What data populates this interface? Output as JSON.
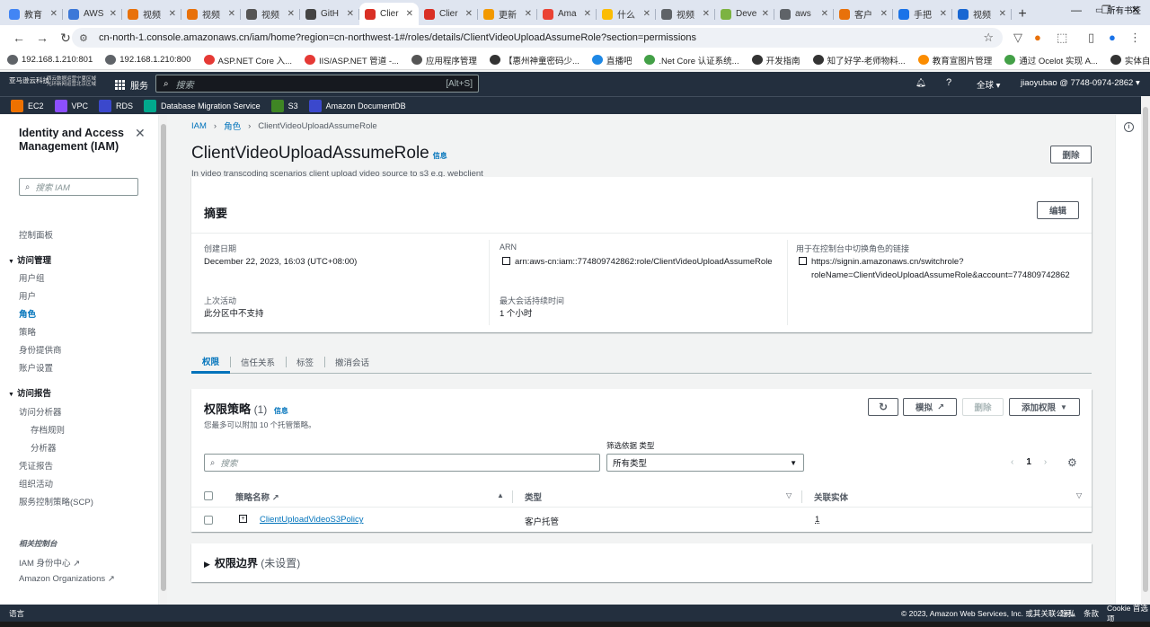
{
  "browser": {
    "tabs": [
      {
        "label": "教育",
        "color": "#4285f4"
      },
      {
        "label": "AWS",
        "color": "#3c78d8"
      },
      {
        "label": "视频",
        "color": "#e8710a"
      },
      {
        "label": "视频",
        "color": "#e8710a"
      },
      {
        "label": "视频",
        "color": "#555555"
      },
      {
        "label": "GitH",
        "color": "#444444"
      },
      {
        "label": "Clier",
        "color": "#d93025",
        "active": true
      },
      {
        "label": "Clier",
        "color": "#d93025"
      },
      {
        "label": "更新",
        "color": "#f29900"
      },
      {
        "label": "Ama",
        "color": "#ea4335"
      },
      {
        "label": "什么",
        "color": "#fbbc04"
      },
      {
        "label": "视频",
        "color": "#5f6368"
      },
      {
        "label": "Deve",
        "color": "#7cb342"
      },
      {
        "label": "aws",
        "color": "#5f6368"
      },
      {
        "label": "客户",
        "color": "#e8710a"
      },
      {
        "label": "手把",
        "color": "#1a73e8"
      },
      {
        "label": "视频",
        "color": "#1967d2"
      }
    ],
    "new_tab": "+",
    "url": "cn-north-1.console.amazonaws.cn/iam/home?region=cn-northwest-1#/roles/details/ClientVideoUploadAssumeRole?section=permissions",
    "bookmarks": [
      {
        "label": "192.168.1.210:801",
        "color": "#5f6368"
      },
      {
        "label": "192.168.1.210:800",
        "color": "#5f6368"
      },
      {
        "label": "ASP.NET Core 入...",
        "color": "#e53935"
      },
      {
        "label": "IIS/ASP.NET 管道 -...",
        "color": "#e53935"
      },
      {
        "label": "应用程序管理",
        "color": "#555555"
      },
      {
        "label": "【惠州神童密码少...",
        "color": "#333333"
      },
      {
        "label": "直播吧",
        "color": "#1e88e5"
      },
      {
        "label": ".Net Core 认证系统...",
        "color": "#43a047"
      },
      {
        "label": "开发指南",
        "color": "#333333"
      },
      {
        "label": "知了好学-老师物料...",
        "color": "#333333"
      },
      {
        "label": "教育宣图片管理",
        "color": "#fb8c00"
      },
      {
        "label": "通过 Ocelot 实现 A...",
        "color": "#43a047"
      },
      {
        "label": "实体自动生成器",
        "color": "#333333"
      }
    ],
    "all_bookmarks": "所有书签"
  },
  "aws_nav": {
    "logo_line1": "亚马逊云科技",
    "logo_line2a": "西云数据运营宁夏区域",
    "logo_line2b": "光环新网运营北京区域",
    "services_label": "服务",
    "search_placeholder": "搜索",
    "search_shortcut": "[Alt+S]",
    "region": "全球 ▾",
    "account": "jiaoyubao @ 7748-0974-2862 ▾"
  },
  "favorites": [
    {
      "label": "EC2",
      "color": "#ed7100",
      "abbr": "EC2"
    },
    {
      "label": "VPC",
      "color": "#8c4fff",
      "abbr": "VPC"
    },
    {
      "label": "RDS",
      "color": "#3b48cc",
      "abbr": "RDS"
    },
    {
      "label": "Database Migration Service",
      "color": "#01a88d",
      "abbr": "DMS"
    },
    {
      "label": "S3",
      "color": "#3f8624",
      "abbr": "S3"
    },
    {
      "label": "Amazon DocumentDB",
      "color": "#3b48cc",
      "abbr": "DB"
    }
  ],
  "sidebar": {
    "title": "Identity and Access Management (IAM)",
    "search_placeholder": "搜索 IAM",
    "dashboard": "控制面板",
    "access_mgmt": "访问管理",
    "access_items": [
      "用户组",
      "用户",
      "角色",
      "策略",
      "身份提供商",
      "账户设置"
    ],
    "access_reports": "访问报告",
    "report_items": [
      "访问分析器",
      "存档规则",
      "分析器",
      "凭证报告",
      "组织活动",
      "服务控制策略(SCP)"
    ],
    "related": "相关控制台",
    "related_items": [
      "IAM 身份中心",
      "Amazon Organizations"
    ]
  },
  "breadcrumb": {
    "root": "IAM",
    "mid": "角色",
    "current": "ClientVideoUploadAssumeRole"
  },
  "role": {
    "name": "ClientVideoUploadAssumeRole",
    "info": "信息",
    "description": "In video transcoding scenarios client upload video source to s3 e.g. webclient",
    "delete_label": "删除"
  },
  "summary": {
    "title": "摘要",
    "edit_label": "编辑",
    "created_label": "创建日期",
    "created_value": "December 22, 2023, 16:03 (UTC+08:00)",
    "arn_label": "ARN",
    "arn_value": "arn:aws-cn:iam::774809742862:role/ClientVideoUploadAssumeRole",
    "switch_label": "用于在控制台中切换角色的链接",
    "switch_value_1": "https://signin.amazonaws.cn/switchrole?",
    "switch_value_2": "roleName=ClientVideoUploadAssumeRole&account=774809742862",
    "last_activity_label": "上次活动",
    "last_activity_value": "此分区中不支持",
    "max_session_label": "最大会话持续时间",
    "max_session_value": "1 个小时"
  },
  "tabs": [
    "权限",
    "信任关系",
    "标签",
    "撤消会话"
  ],
  "permissions": {
    "title": "权限策略",
    "count": "(1)",
    "info": "信息",
    "subtitle": "您最多可以附加 10 个托管策略。",
    "refresh_icon": "refresh-icon",
    "simulate_label": "模拟",
    "remove_label": "删除",
    "add_label": "添加权限",
    "filter_label": "筛选依据 类型",
    "search_placeholder": "搜索",
    "filter_value": "所有类型",
    "page": "1",
    "columns": {
      "name": "策略名称",
      "type": "类型",
      "entities": "关联实体"
    },
    "rows": [
      {
        "name": "ClientUploadVideoS3Policy",
        "type": "客户托管",
        "entities": "1"
      }
    ]
  },
  "boundary": {
    "title": "权限边界",
    "status": "(未设置)"
  },
  "footer": {
    "lang": "语言",
    "copyright": "© 2023, Amazon Web Services, Inc. 或其关联公司。",
    "privacy": "隐私",
    "terms": "条款",
    "cookies": "Cookie 首选项"
  }
}
